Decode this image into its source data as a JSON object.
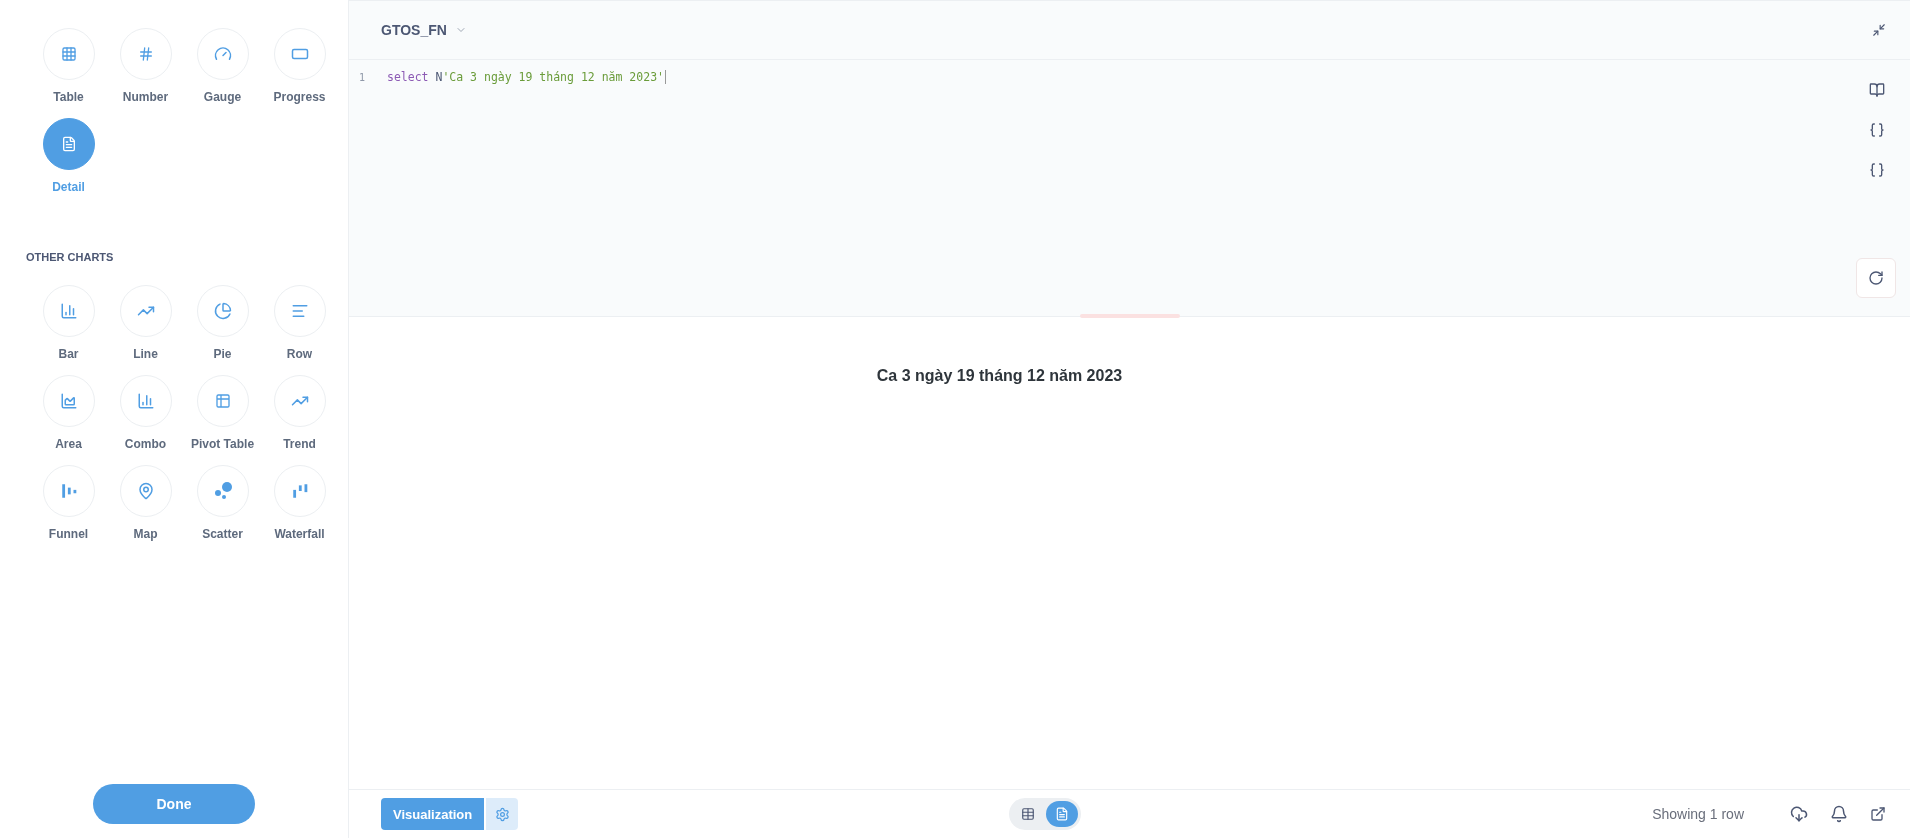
{
  "chart_picker": {
    "main": [
      {
        "label": "Table",
        "selected": false
      },
      {
        "label": "Number",
        "selected": false
      },
      {
        "label": "Gauge",
        "selected": false
      },
      {
        "label": "Progress",
        "selected": false
      },
      {
        "label": "Detail",
        "selected": true
      }
    ],
    "other_heading": "OTHER CHARTS",
    "other": [
      {
        "label": "Bar",
        "selected": false
      },
      {
        "label": "Line",
        "selected": false
      },
      {
        "label": "Pie",
        "selected": false
      },
      {
        "label": "Row",
        "selected": false
      },
      {
        "label": "Area",
        "selected": false
      },
      {
        "label": "Combo",
        "selected": false
      },
      {
        "label": "Pivot Table",
        "selected": false
      },
      {
        "label": "Trend",
        "selected": false
      },
      {
        "label": "Funnel",
        "selected": false
      },
      {
        "label": "Map",
        "selected": false
      },
      {
        "label": "Scatter",
        "selected": false
      },
      {
        "label": "Waterfall",
        "selected": false
      }
    ],
    "done_button": "Done"
  },
  "editor": {
    "database": "GTOS_FN",
    "lines": [
      {
        "number": "1",
        "tokens": [
          {
            "kind": "keyword",
            "text": "select"
          },
          {
            "kind": "plain",
            "text": "N"
          },
          {
            "kind": "string",
            "text": "'Ca 3 ngày 19 tháng 12 năm 2023'"
          }
        ]
      }
    ]
  },
  "result": {
    "value": "Ca 3 ngày 19 tháng 12 năm 2023"
  },
  "footer": {
    "visualization_button": "Visualization",
    "view_toggle": [
      {
        "kind": "table",
        "selected": false
      },
      {
        "kind": "detail",
        "selected": true
      }
    ],
    "row_count": "Showing 1 row"
  }
}
